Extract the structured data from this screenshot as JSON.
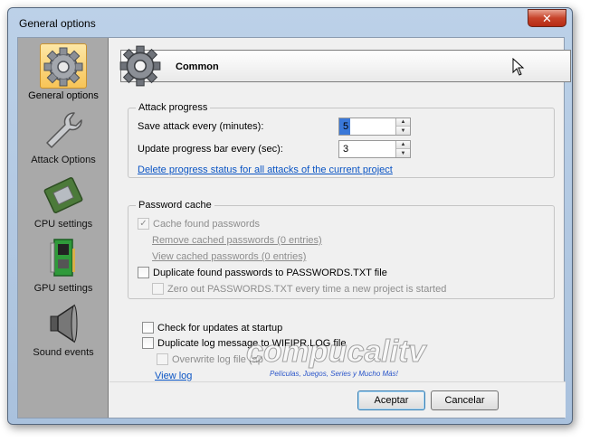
{
  "window": {
    "title": "General options",
    "close_glyph": "✕"
  },
  "sidebar": {
    "items": [
      {
        "label": "General options",
        "icon": "gear-icon",
        "selected": true
      },
      {
        "label": "Attack Options",
        "icon": "wrench-icon",
        "selected": false
      },
      {
        "label": "CPU settings",
        "icon": "cpu-icon",
        "selected": false
      },
      {
        "label": "GPU settings",
        "icon": "gpu-card-icon",
        "selected": false
      },
      {
        "label": "Sound events",
        "icon": "speaker-icon",
        "selected": false
      }
    ]
  },
  "header": {
    "title": "Common"
  },
  "attack_progress": {
    "legend": "Attack progress",
    "save_label": "Save attack every (minutes):",
    "save_value": "5",
    "update_label": "Update progress bar every (sec):",
    "update_value": "3",
    "delete_link": "Delete progress status for all attacks of the current project"
  },
  "password_cache": {
    "legend": "Password cache",
    "cache_found": {
      "label": "Cache found passwords",
      "checked": true,
      "disabled": true
    },
    "remove_link": "Remove cached passwords (0 entries)",
    "view_link": "View cached passwords  (0 entries)",
    "duplicate": {
      "label": "Duplicate found passwords to PASSWORDS.TXT file",
      "checked": false
    },
    "zero_out": {
      "label": "Zero out PASSWORDS.TXT every time a new project is started",
      "checked": false,
      "disabled": true
    }
  },
  "misc": {
    "check_updates": {
      "label": "Check for updates at startup",
      "checked": false
    },
    "duplicate_log": {
      "label": "Duplicate log message to WIFIPR.LOG file",
      "checked": false
    },
    "overwrite_log": {
      "label": "Overwrite log file (ap",
      "checked": false,
      "disabled": true
    },
    "view_log_link": "View log"
  },
  "buttons": {
    "accept": "Aceptar",
    "cancel": "Cancelar"
  },
  "watermark": {
    "brand": "compucalitv",
    "tagline": "Películas, Juegos, Series y Mucho Más!"
  },
  "colors": {
    "link": "#0b55c4",
    "selected_bg": "#f7c457",
    "close": "#c7432a",
    "sidebar_bg": "#a9a9a9"
  }
}
